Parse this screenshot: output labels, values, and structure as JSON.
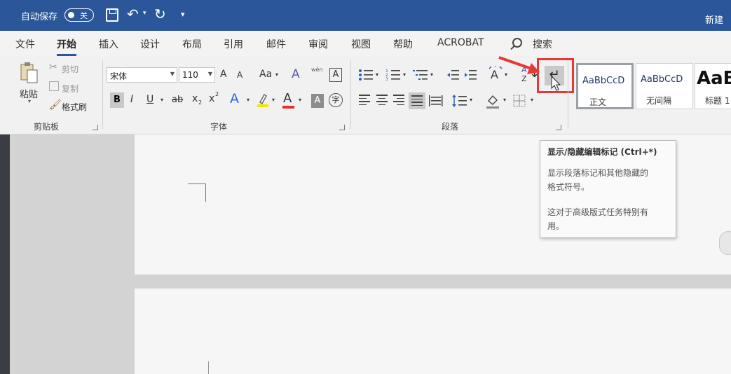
{
  "titlebar": {
    "autosave_label": "自动保存",
    "toggle_state": "关",
    "doc_name": "新建"
  },
  "tabs": [
    {
      "label": "文件"
    },
    {
      "label": "开始"
    },
    {
      "label": "插入"
    },
    {
      "label": "设计"
    },
    {
      "label": "布局"
    },
    {
      "label": "引用"
    },
    {
      "label": "邮件"
    },
    {
      "label": "审阅"
    },
    {
      "label": "视图"
    },
    {
      "label": "帮助"
    },
    {
      "label": "ACROBAT"
    }
  ],
  "search_label": "搜索",
  "clipboard": {
    "paste": "粘贴",
    "cut": "剪切",
    "copy": "复制",
    "format_painter": "格式刷",
    "group_label": "剪贴板"
  },
  "font": {
    "name": "宋体",
    "size": "110",
    "grow": "A",
    "shrink": "A",
    "case": "Aa",
    "wen": "wén",
    "bold": "B",
    "italic": "I",
    "underline": "U",
    "strike": "ab",
    "subscript": "x",
    "superscript": "x",
    "font_color": "A",
    "shading": "A",
    "enclose": "字",
    "group_label": "字体"
  },
  "paragraph": {
    "sort": "A",
    "sort_z": "Z",
    "group_label": "段落"
  },
  "styles": [
    {
      "sample": "AaBbCcD",
      "name": "正文"
    },
    {
      "sample": "AaBbCcD",
      "name": "无间隔"
    },
    {
      "sample": "AaB",
      "name": "标题 1"
    }
  ],
  "tooltip": {
    "title": "显示/隐藏编辑标记 (Ctrl+*)",
    "line1": "显示段落标记和其他隐藏的",
    "line2": "格式符号。",
    "line3": "这对于高级版式任务特别有",
    "line4": "用。"
  },
  "colors": {
    "brand": "#2b579a",
    "annotation_red": "#e53935"
  }
}
